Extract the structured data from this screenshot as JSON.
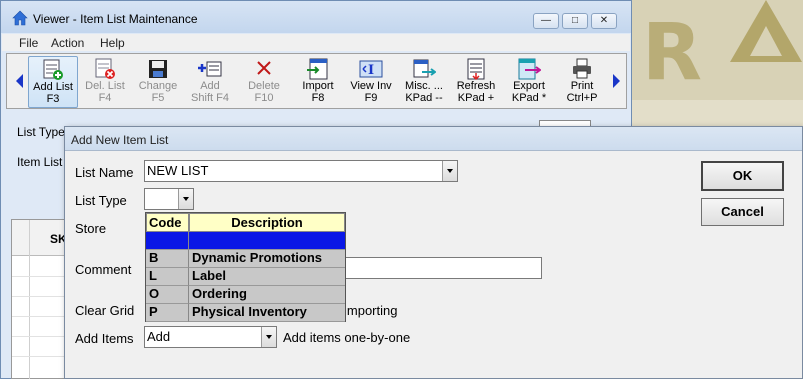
{
  "window": {
    "title": "Viewer - Item List Maintenance"
  },
  "menu": {
    "file": "File",
    "action": "Action",
    "help": "Help"
  },
  "toolbar": {
    "items": [
      {
        "label": "Add List",
        "key": "F3"
      },
      {
        "label": "Del. List",
        "key": "F4"
      },
      {
        "label": "Change",
        "key": "F5"
      },
      {
        "label": "Add",
        "key": "Shift F4"
      },
      {
        "label": "Delete",
        "key": "F10"
      },
      {
        "label": "Import",
        "key": "F8"
      },
      {
        "label": "View Inv",
        "key": "F9"
      },
      {
        "label": "Misc. ...",
        "key": "KPad --"
      },
      {
        "label": "Refresh",
        "key": "KPad +"
      },
      {
        "label": "Export",
        "key": "KPad *"
      },
      {
        "label": "Print",
        "key": "Ctrl+P"
      }
    ]
  },
  "background": {
    "list_type_label": "List Type",
    "item_list_label": "Item List",
    "grid_header": "SK"
  },
  "dialog": {
    "title": "Add New Item List",
    "list_name_label": "List Name",
    "list_name_value": "NEW LIST",
    "list_type_label": "List Type",
    "list_type_value": "",
    "store_label": "Store",
    "comment_label": "Comment",
    "clear_grid_label": "Clear Grid",
    "clear_grid_desc": "importing",
    "add_items_label": "Add Items",
    "add_items_value": "Add",
    "add_items_desc": "Add items one-by-one",
    "ok_label": "OK",
    "cancel_label": "Cancel"
  },
  "list_type_popup": {
    "code_header": "Code",
    "desc_header": "Description",
    "rows": [
      {
        "code": "",
        "desc": ""
      },
      {
        "code": "B",
        "desc": "Dynamic Promotions"
      },
      {
        "code": "L",
        "desc": "Label"
      },
      {
        "code": "O",
        "desc": "Ordering"
      },
      {
        "code": "P",
        "desc": "Physical Inventory"
      }
    ]
  },
  "colors": {
    "selection": "#0a17e6",
    "popup_header": "#ffffc6",
    "nav_arrow": "#1a36c8"
  }
}
